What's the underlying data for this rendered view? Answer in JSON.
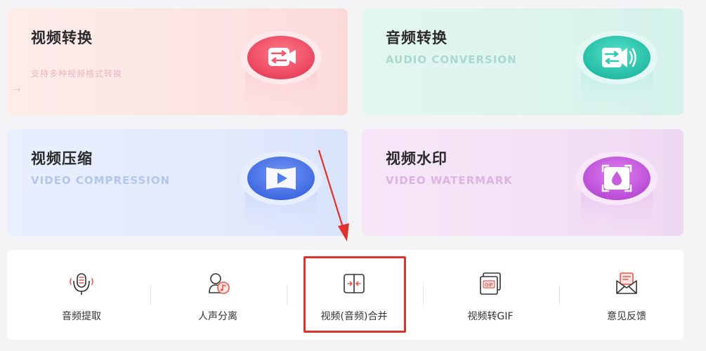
{
  "cards": {
    "video_convert": {
      "title": "视频转换",
      "subtitle": "支持多种视频格式转换"
    },
    "audio_convert": {
      "title": "音频转换",
      "subtitle": "AUDIO CONVERSION"
    },
    "video_compress": {
      "title": "视频压缩",
      "subtitle": "VIDEO COMPRESSION"
    },
    "video_watermark": {
      "title": "视频水印",
      "subtitle": "VIDEO WATERMARK"
    }
  },
  "tools": [
    {
      "label": "音频提取",
      "icon": "microphone-icon"
    },
    {
      "label": "人声分离",
      "icon": "voice-separate-icon"
    },
    {
      "label": "视频(音频)合并",
      "icon": "merge-icon"
    },
    {
      "label": "视频转GIF",
      "icon": "gif-icon"
    },
    {
      "label": "意见反馈",
      "icon": "feedback-mail-icon"
    }
  ],
  "colors": {
    "video_convert": "#f4546a",
    "audio_convert": "#2dcbb4",
    "video_compress": "#4f7cf0",
    "video_watermark": "#c85ce0",
    "tool_accent": "#e9574f",
    "highlight": "#e0322b"
  }
}
